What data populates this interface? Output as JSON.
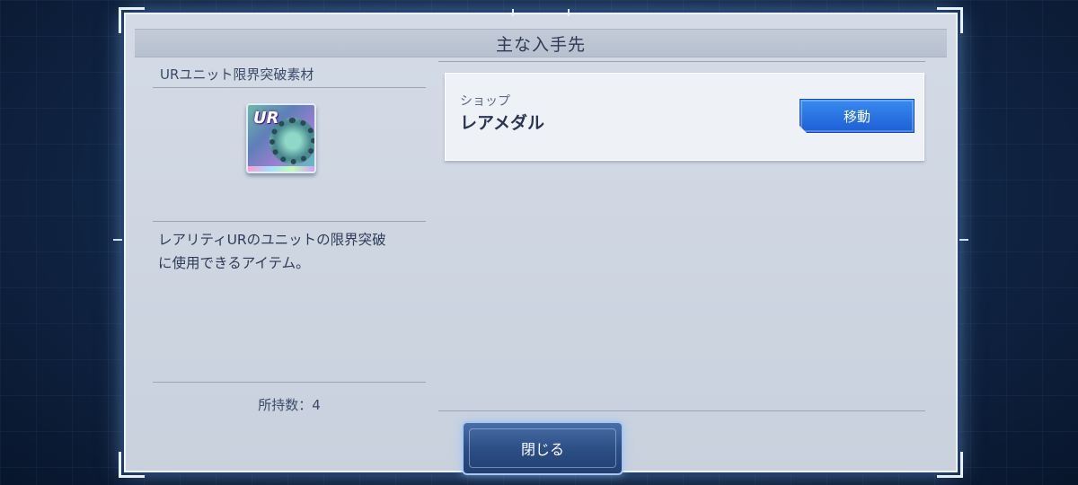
{
  "dialog": {
    "title": "主な入手先"
  },
  "item": {
    "name": "URユニット限界突破素材",
    "icon": "ur-gear-icon",
    "icon_badge": "UR",
    "description_line1": "レアリティURのユニットの限界突破",
    "description_line2": "に使用できるアイテム。",
    "owned": "所持数：4"
  },
  "sources": [
    {
      "category": "ショップ",
      "name": "レアメダル",
      "button_label": "移動"
    }
  ],
  "footer": {
    "close_label": "閉じる"
  },
  "colors": {
    "accent_blue": "#1c5fd6",
    "panel": "#d4dbe6",
    "text": "#2e3b58"
  }
}
